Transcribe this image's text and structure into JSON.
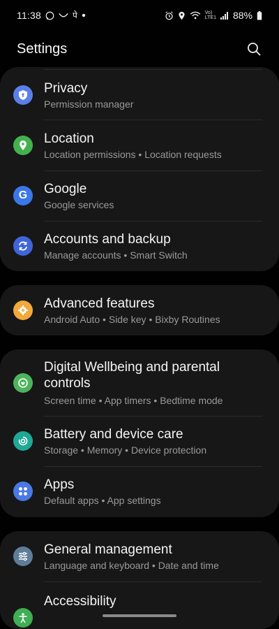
{
  "status": {
    "time": "11:38",
    "left_icons": [
      "whatsapp-icon",
      "messaging-icon",
      "pe-app-icon",
      "dot"
    ],
    "pe_glyph": "पे",
    "network_top": "Vo)",
    "network_bottom": "LTE1",
    "battery": "88%"
  },
  "header": {
    "title": "Settings"
  },
  "cards": [
    {
      "items": [
        {
          "title": "Privacy",
          "subtitle": "Permission manager",
          "icon": "privacy-shield-icon",
          "color": "#5b7fe8"
        },
        {
          "title": "Location",
          "subtitle": "Location permissions  •  Location requests",
          "icon": "location-pin-icon",
          "color": "#43b24e"
        },
        {
          "title": "Google",
          "subtitle": "Google services",
          "icon": "google-icon",
          "color": "#3b78e7"
        },
        {
          "title": "Accounts and backup",
          "subtitle": "Manage accounts  •  Smart Switch",
          "icon": "sync-icon",
          "color": "#3f65d8"
        }
      ]
    },
    {
      "items": [
        {
          "title": "Advanced features",
          "subtitle": "Android Auto  •  Side key  •  Bixby Routines",
          "icon": "gear-plus-icon",
          "color": "#f2a93b"
        }
      ]
    },
    {
      "items": [
        {
          "title": "Digital Wellbeing and parental controls",
          "subtitle": "Screen time  •  App timers  •  Bedtime mode",
          "icon": "wellbeing-icon",
          "color": "#4eb35c"
        },
        {
          "title": "Battery and device care",
          "subtitle": "Storage  •  Memory  •  Device protection",
          "icon": "device-care-icon",
          "color": "#1fa895"
        },
        {
          "title": "Apps",
          "subtitle": "Default apps  •  App settings",
          "icon": "apps-grid-icon",
          "color": "#4a78e4"
        }
      ]
    },
    {
      "items": [
        {
          "title": "General management",
          "subtitle": "Language and keyboard  •  Date and time",
          "icon": "sliders-icon",
          "color": "#5f7d98"
        },
        {
          "title": "Accessibility",
          "subtitle": "",
          "icon": "accessibility-icon",
          "color": "#3fae54"
        }
      ]
    }
  ]
}
